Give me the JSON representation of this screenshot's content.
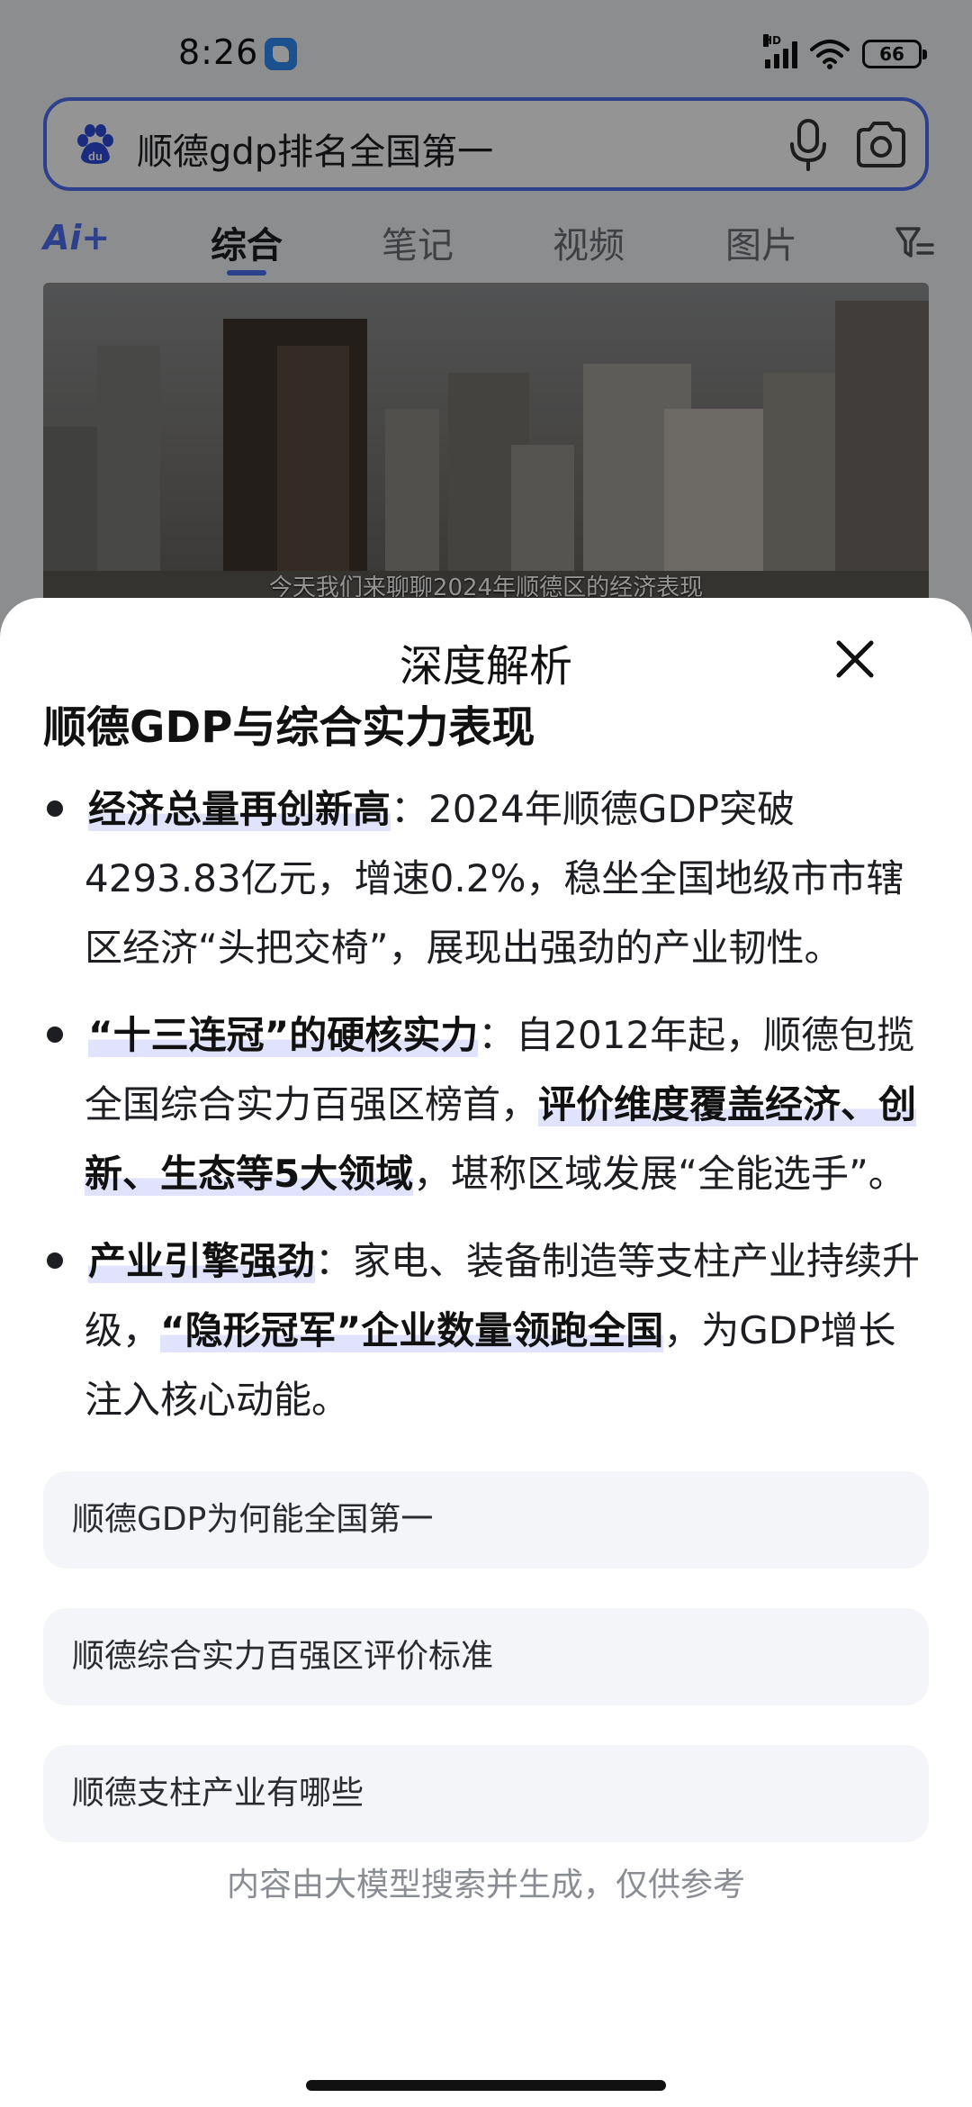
{
  "status_bar": {
    "time": "8:26",
    "network_label": "HD",
    "battery": "66",
    "icons": [
      "app-notification-icon",
      "signal-icon",
      "wifi-icon",
      "battery-icon"
    ]
  },
  "search": {
    "query": "顺德gdp排名全国第一",
    "icons": [
      "baidu-paw-icon",
      "microphone-icon",
      "camera-icon"
    ],
    "accent_color": "#4e6ef2"
  },
  "tabs": {
    "ai_label": "Ai+",
    "items": [
      {
        "label": "综合",
        "active": true
      },
      {
        "label": "笔记",
        "active": false
      },
      {
        "label": "视频",
        "active": false
      },
      {
        "label": "图片",
        "active": false
      }
    ]
  },
  "video": {
    "caption": "今天我们来聊聊2024年顺德区的经济表现"
  },
  "sheet": {
    "title": "深度解析",
    "heading": "顺德GDP与综合实力表现",
    "bullets": [
      {
        "parts": [
          {
            "text": "经济总量再创新高",
            "highlight": true
          },
          {
            "text": "：2024年顺德GDP突破4293.83亿元，增速0.2%，稳坐全国地级市市辖区经济“头把交椅”，展现出强劲的产业韧性。",
            "highlight": false
          }
        ]
      },
      {
        "parts": [
          {
            "text": "“十三连冠”的硬核实力",
            "highlight": true
          },
          {
            "text": "：自2012年起，顺德包揽全国综合实力百强区榜首，",
            "highlight": false
          },
          {
            "text": "评价维度覆盖经济、创新、生态等5大领域",
            "highlight": true
          },
          {
            "text": "，堪称区域发展“全能选手”。",
            "highlight": false
          }
        ]
      },
      {
        "parts": [
          {
            "text": "产业引擎强劲",
            "highlight": true
          },
          {
            "text": "：家电、装备制造等支柱产业持续升级，",
            "highlight": false
          },
          {
            "text": "“隐形冠军”企业数量领跑全国",
            "highlight": true
          },
          {
            "text": "，为GDP增长注入核心动能。",
            "highlight": false
          }
        ]
      }
    ],
    "suggestions": [
      "顺德GDP为何能全国第一",
      "顺德综合实力百强区评价标准",
      "顺德支柱产业有哪些"
    ],
    "disclaimer": "内容由大模型搜索并生成，仅供参考"
  }
}
